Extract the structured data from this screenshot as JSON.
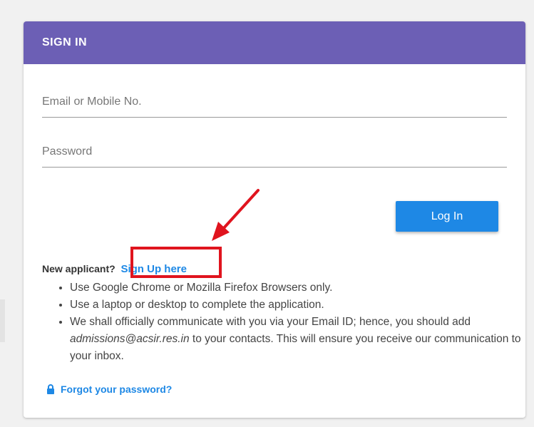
{
  "signin": {
    "title": "SIGN IN",
    "email_placeholder": "Email or Mobile No.",
    "password_placeholder": "Password",
    "login_label": "Log In"
  },
  "signup": {
    "prompt": "New applicant?",
    "link_label": "Sign Up here"
  },
  "instructions": {
    "item1": "Use Google Chrome or Mozilla Firefox Browsers only.",
    "item2": "Use a laptop or desktop to complete the application.",
    "item3_pre": "We shall officially communicate with you via your Email ID; hence, you should add ",
    "item3_email": "admissions@acsir.res.in",
    "item3_post": " to your contacts. This will ensure you receive our communication to your inbox."
  },
  "forgot": {
    "label": "Forgot your password?",
    "icon": "lock-icon"
  },
  "colors": {
    "header": "#6c5fb5",
    "primary": "#1e88e5",
    "highlight": "#e0141e"
  }
}
